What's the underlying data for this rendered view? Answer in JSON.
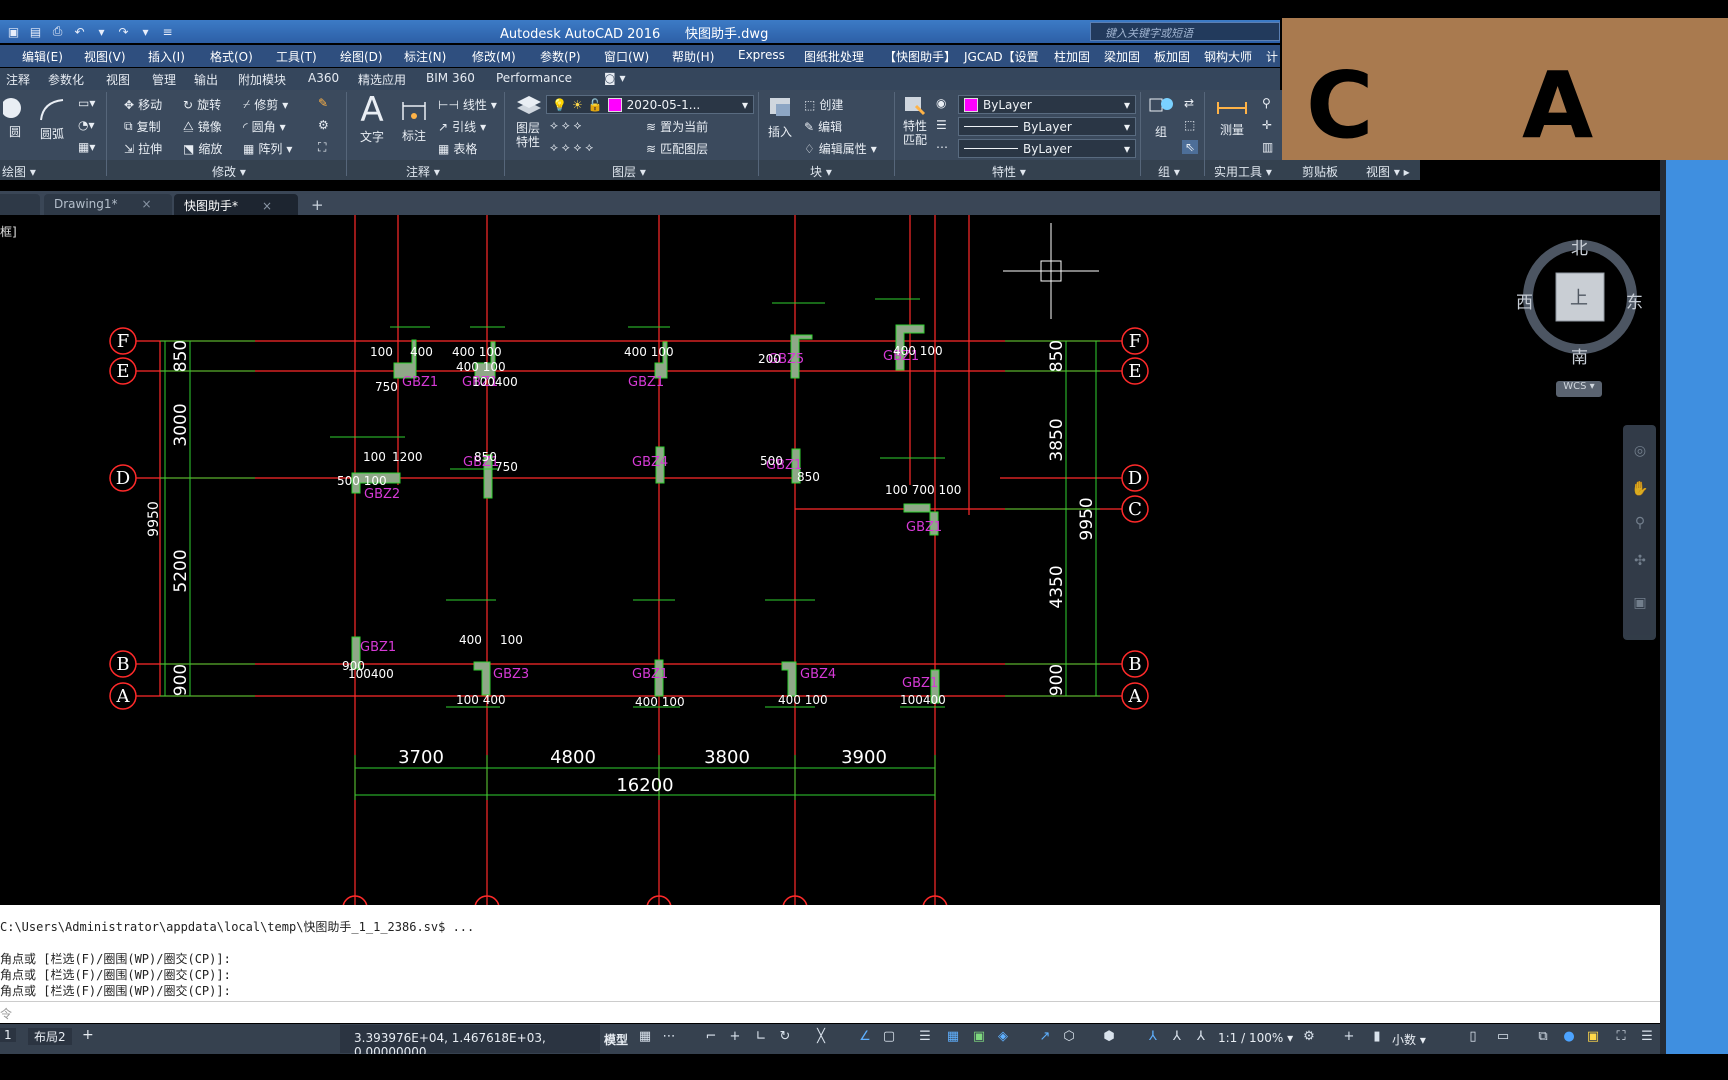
{
  "title": {
    "app": "Autodesk AutoCAD 2016",
    "file": "快图助手.dwg"
  },
  "search": {
    "placeholder": "键入关键字或短语"
  },
  "menubar": [
    "编辑(E)",
    "视图(V)",
    "插入(I)",
    "格式(O)",
    "工具(T)",
    "绘图(D)",
    "标注(N)",
    "修改(M)",
    "参数(P)",
    "窗口(W)",
    "帮助(H)",
    "Express",
    "图纸批处理",
    "【快图助手】",
    "JGCAD【设置",
    "柱加固",
    "梁加固",
    "板加固",
    "钢构大师",
    "计"
  ],
  "ribbon_tabs": [
    "注释",
    "参数化",
    "视图",
    "管理",
    "输出",
    "附加模块",
    "A360",
    "精选应用",
    "BIM 360",
    "Performance"
  ],
  "ribbon": {
    "draw": {
      "title": "绘图",
      "circle": "圆",
      "arc": "圆弧"
    },
    "modify": {
      "title": "修改",
      "move": "移动",
      "rotate": "旋转",
      "trim": "修剪",
      "copy": "复制",
      "mirror": "镜像",
      "fillet": "圆角",
      "stretch": "拉伸",
      "scale": "缩放",
      "array": "阵列"
    },
    "annotation": {
      "title": "注释",
      "text": "文字",
      "dimension": "标注",
      "linear": "线性",
      "leader": "引线",
      "table": "表格"
    },
    "layers": {
      "title": "图层",
      "properties": "图层\n特性",
      "layer_name": "2020-05-1...",
      "set_current": "置为当前",
      "match_layer": "匹配图层"
    },
    "block": {
      "title": "块",
      "insert": "插入",
      "create": "创建",
      "edit": "编辑",
      "edit_attr": "编辑属性"
    },
    "properties": {
      "title": "特性",
      "match": "特性\n匹配",
      "color": "ByLayer",
      "linetype": "ByLayer",
      "lineweight": "ByLayer"
    },
    "groups": {
      "title": "组",
      "group": "组"
    },
    "utilities": {
      "title": "实用工具",
      "measure": "测量"
    },
    "clipboard": {
      "title": "剪贴板"
    },
    "view": {
      "title": "视图"
    }
  },
  "overlay": {
    "left": "C",
    "right": "A"
  },
  "file_tabs": [
    {
      "label": "Drawing1*"
    },
    {
      "label": "快图助手*"
    }
  ],
  "viewport_label": "框]",
  "viewcube": {
    "north": "北",
    "south": "南",
    "west": "西",
    "east": "东",
    "face": "上",
    "wcs": "WCS"
  },
  "drawing": {
    "axes_h": [
      "F",
      "E",
      "D",
      "C",
      "B",
      "A"
    ],
    "dims_left": [
      "850",
      "3000",
      "5200",
      "900",
      "9950"
    ],
    "dims_right": [
      "850",
      "3850",
      "4350",
      "900",
      "9950"
    ],
    "dims_bottom": [
      "3700",
      "4800",
      "3800",
      "3900",
      "16200"
    ],
    "columns": [
      "GBZ1",
      "GBZ1",
      "GBZ1",
      "GBZ5",
      "GBZ1",
      "GBZ2",
      "GBZ1",
      "GBZ4",
      "GBZ1",
      "GBZ1",
      "GBZ1",
      "GBZ3",
      "GBZ1",
      "GBZ4",
      "GBZ1"
    ],
    "small_dims": [
      "100",
      "400",
      "750",
      "400 100",
      "400 100",
      "100400",
      "100",
      "850",
      "500 100",
      "200",
      "400 100",
      "750",
      "1200",
      "500",
      "850",
      "100 700 100",
      "400 100",
      "400",
      "100",
      "900",
      "100400",
      "100 400",
      "400 100",
      "400 100",
      "100400"
    ]
  },
  "command": {
    "lines": [
      "C:\\Users\\Administrator\\appdata\\local\\temp\\快图助手_1_1_2386.sv$ ...",
      "",
      "角点或 [栏选(F)/圈围(WP)/圈交(CP)]:",
      "角点或 [栏选(F)/圈围(WP)/圈交(CP)]:",
      "角点或 [栏选(F)/圈围(WP)/圈交(CP)]:"
    ],
    "input_placeholder": "令"
  },
  "layout_tabs": [
    "1",
    "布局2",
    "+"
  ],
  "status": {
    "coords": "3.393976E+04, 1.467618E+03, 0.00000000",
    "model": "模型",
    "scale": "1:1 / 100%",
    "units": "小数"
  },
  "colors": {
    "axis_red": "#ff2a2a",
    "dim_green": "#2fd12f",
    "label_magenta": "#d63ad6",
    "column_fill": "#8fa888",
    "accent_magenta": "#ff00ff"
  }
}
